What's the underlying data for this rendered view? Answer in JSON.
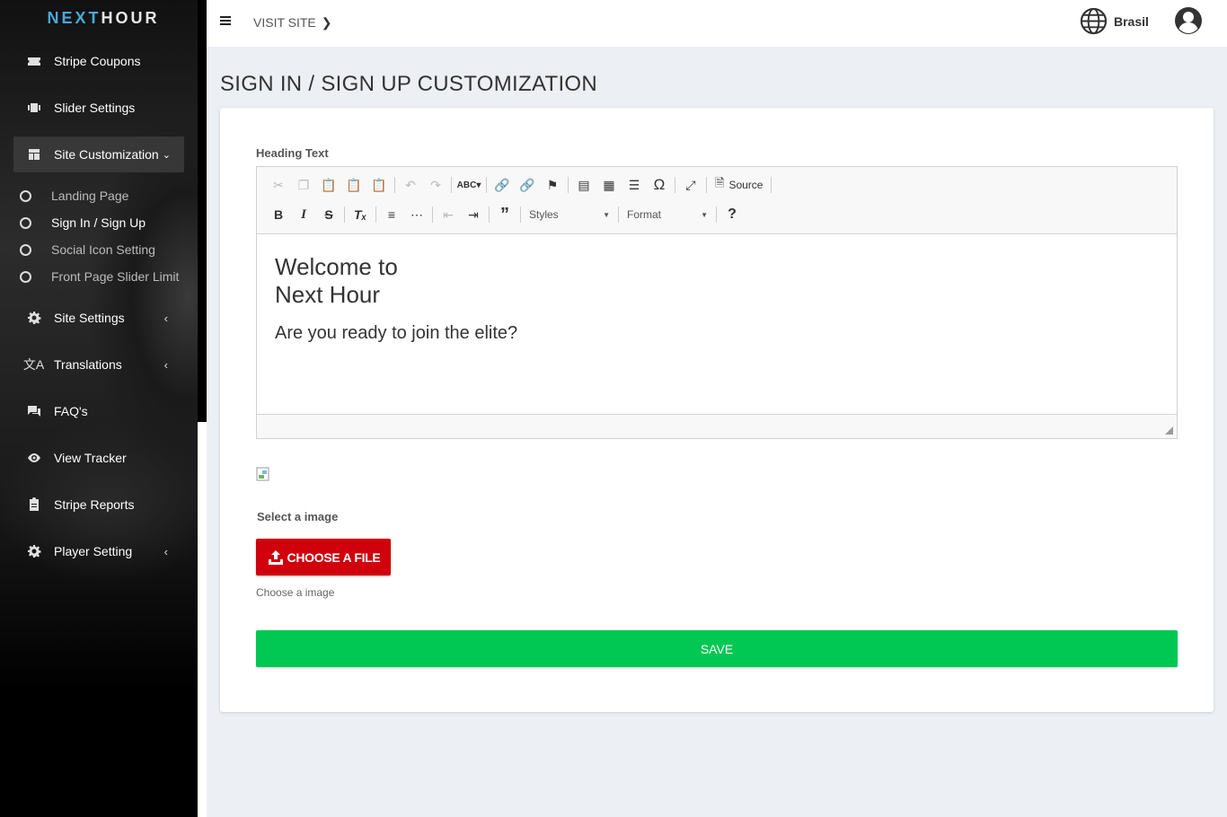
{
  "app": {
    "logo_left": "NEXT",
    "logo_right": "HOUR"
  },
  "sidebar": {
    "items": [
      {
        "label": "Stripe Coupons",
        "icon": "ticket-icon"
      },
      {
        "label": "Slider Settings",
        "icon": "slider-icon"
      },
      {
        "label": "Site Customization",
        "icon": "layout-icon",
        "active": true
      },
      {
        "label": "Site Settings",
        "icon": "gear-icon"
      },
      {
        "label": "Translations",
        "icon": "translate-icon"
      },
      {
        "label": "FAQ's",
        "icon": "chat-icon"
      },
      {
        "label": "View Tracker",
        "icon": "eye-icon"
      },
      {
        "label": "Stripe Reports",
        "icon": "clipboard-icon"
      },
      {
        "label": "Player Setting",
        "icon": "gear-icon"
      }
    ],
    "subitems": [
      {
        "label": "Landing Page"
      },
      {
        "label": "Sign In / Sign Up",
        "selected": true
      },
      {
        "label": "Social Icon Setting"
      },
      {
        "label": "Front Page Slider Limit"
      }
    ]
  },
  "topbar": {
    "visit_site": "VISIT SITE",
    "language": "Brasil"
  },
  "page": {
    "title": "SIGN IN / SIGN UP CUSTOMIZATION"
  },
  "form": {
    "heading_label": "Heading Text",
    "editor": {
      "source_label": "Source",
      "styles_label": "Styles",
      "format_label": "Format",
      "heading_line1": "Welcome to",
      "heading_line2": "Next Hour",
      "paragraph": "Are you ready to join the elite?"
    },
    "select_image_label": "Select a image",
    "choose_file_label": "CHOOSE A FILE",
    "choose_helper": "Choose a image",
    "save_label": "SAVE"
  },
  "colors": {
    "choose_button": "#d0000d",
    "save_button": "#00c853",
    "logo_accent": "#4aa8d8"
  }
}
